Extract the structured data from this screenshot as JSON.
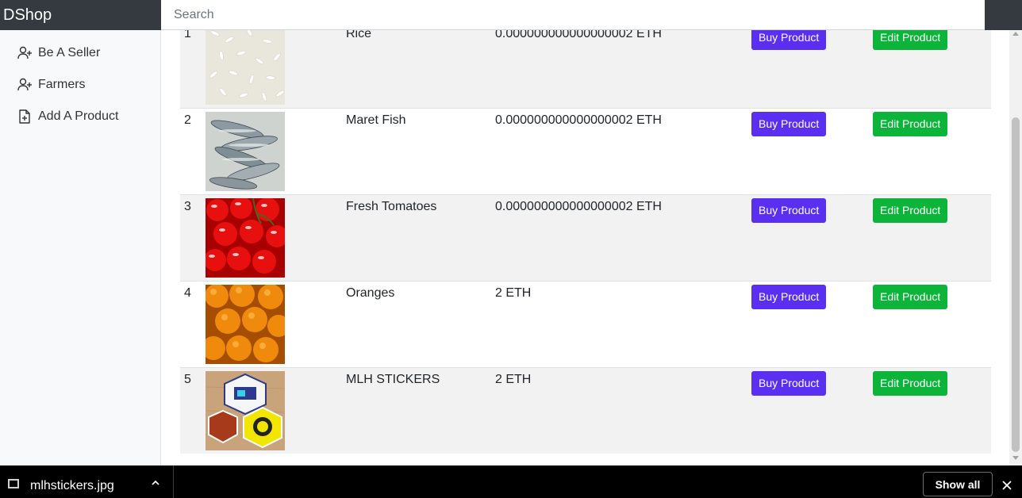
{
  "navbar": {
    "brand": "DShop",
    "search_placeholder": "Search"
  },
  "sidebar": {
    "items": [
      {
        "label": "Be A Seller",
        "icon": "person-add-icon"
      },
      {
        "label": "Farmers",
        "icon": "person-add-icon"
      },
      {
        "label": "Add A Product",
        "icon": "file-plus-icon"
      }
    ]
  },
  "products": [
    {
      "num": "1",
      "name": "Rice",
      "price": "0.000000000000000002 ETH",
      "image": "rice-image",
      "buy_label": "Buy Product",
      "edit_label": "Edit Product"
    },
    {
      "num": "2",
      "name": "Maret Fish",
      "price": "0.000000000000000002 ETH",
      "image": "fish-image",
      "buy_label": "Buy Product",
      "edit_label": "Edit Product"
    },
    {
      "num": "3",
      "name": "Fresh Tomatoes",
      "price": "0.000000000000000002 ETH",
      "image": "tomatoes-image",
      "buy_label": "Buy Product",
      "edit_label": "Edit Product"
    },
    {
      "num": "4",
      "name": "Oranges",
      "price": "2 ETH",
      "image": "oranges-image",
      "buy_label": "Buy Product",
      "edit_label": "Edit Product"
    },
    {
      "num": "5",
      "name": "MLH STICKERS",
      "price": "2 ETH",
      "image": "stickers-image",
      "buy_label": "Buy Product",
      "edit_label": "Edit Product"
    }
  ],
  "download_bar": {
    "filename": "mlhstickers.jpg",
    "show_all_label": "Show all"
  },
  "colors": {
    "navbar": "#343a40",
    "buy_button": "#5a2ff2",
    "edit_button": "#0cb43a",
    "row_stripe": "#f2f2f2"
  }
}
